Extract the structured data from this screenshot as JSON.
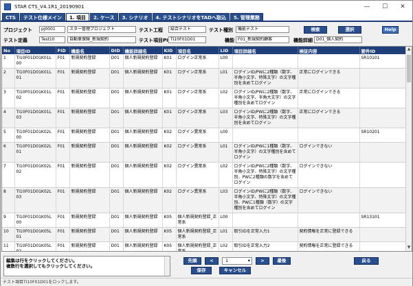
{
  "window": {
    "title": "STAR CTS_V4.1R1_20190901",
    "minimize": "—",
    "maximize": "☐",
    "close": "✕"
  },
  "tabs": [
    "CTS",
    "テスト仕様メイン",
    "1. 項目",
    "2. ケース",
    "3. シナリオ",
    "4. テストシナリオをTADへ取込",
    "5. 管理業務"
  ],
  "active_tab": 2,
  "fields": {
    "project_label": "プロジェクト",
    "project_id": "pj0001",
    "project_name": "スター管理プロジェクト",
    "test_process_label": "テスト工程",
    "test_process_value": "結合テスト",
    "test_type_label": "テスト種別",
    "test_type_value": "機能テスト",
    "test_def_label": "テスト定義",
    "test_def_id": "Test10",
    "test_def_name": "自動車保険_新規契約",
    "test_item_pid_label": "テスト項目PID",
    "test_item_pid_value": "TI10F01D01",
    "function_label": "機能",
    "function_value": "F01_新規契約顧客",
    "function_detail_label": "機能詳細",
    "function_detail_value": "D01_個人契約"
  },
  "buttons": {
    "search": "検索",
    "select": "選択",
    "help": "Help",
    "first": "先頭",
    "prev": "<",
    "next": ">",
    "last": "最後",
    "save": "保存",
    "cancel": "キャンセル",
    "back": "戻る"
  },
  "page_select": "1",
  "columns": [
    "No",
    "項目ID",
    "FID",
    "機能名",
    "DID",
    "機能詳細名",
    "KID",
    "項目名",
    "LID",
    "項目詳細名",
    "検証内容",
    "要件ID"
  ],
  "rows": [
    [
      "1",
      "TI10F01D01K01L00",
      "F01",
      "新規契約登録",
      "D01",
      "個人新規契約登録",
      "K01",
      "ログイン正常系",
      "L00",
      "",
      "",
      "SR10101"
    ],
    [
      "2",
      "TI10F01D01K01L01",
      "F01",
      "新規契約登録",
      "D01",
      "個人新規契約登録",
      "K01",
      "ログイン正常系",
      "L01",
      "ログインID/PWに2種類（数字、半角小文字、特殊文字）の文字種別を含めてログイン",
      "正常にログインできる",
      ""
    ],
    [
      "3",
      "TI10F01D01K01L02",
      "F01",
      "新規契約登録",
      "D01",
      "個人新規契約登録",
      "K01",
      "ログイン正常系",
      "L02",
      "ログインID/PWに2種類（数字、半角小文字、半角大文字）の文字種別を含めてログイン",
      "正常にログインできる",
      ""
    ],
    [
      "4",
      "TI10F01D01K01L03",
      "F01",
      "新規契約登録",
      "D01",
      "個人新規契約登録",
      "K01",
      "ログイン正常系",
      "L03",
      "ログインID/PWに2種類（数字、半角小文字、特殊文字）の文字種別を含めてログイン",
      "正常にログインできる",
      ""
    ],
    [
      "5",
      "TI10F01D01K02L00",
      "F01",
      "新規契約登録",
      "D01",
      "個人新規契約登録",
      "K02",
      "ログイン異常系",
      "L00",
      "",
      "",
      "SR10201"
    ],
    [
      "6",
      "TI10F01D01K02L01",
      "F01",
      "新規契約登録",
      "D01",
      "個人新規契約登録",
      "K02",
      "ログイン異常系",
      "L01",
      "ログインID/PWに1種類（数字、半角小文字）の文字種別を含めてログイン",
      "ログインできない",
      ""
    ],
    [
      "7",
      "TI10F01D01K02L02",
      "F01",
      "新規契約登録",
      "D01",
      "個人新規契約登録",
      "K02",
      "ログイン異常系",
      "L02",
      "ログインID/PWに2種類（数字、半角小文字、特殊文字）の文字種別、PWに2種類の数字を含めてログイン",
      "ログインできない",
      ""
    ],
    [
      "8",
      "TI10F01D01K02L03",
      "F01",
      "新規契約登録",
      "D01",
      "個人新規契約登録",
      "K02",
      "ログイン異常系",
      "L03",
      "ログインID/PWに2種類（数字、半角小文字、特殊文字）の文字種別、PWに1種類（数字）の文字種別を含めてログイン",
      "ログインできない",
      ""
    ],
    [
      "9",
      "TI10F01D01K05L00",
      "F01",
      "新規契約登録",
      "D01",
      "個人新規契約登録",
      "K05",
      "個人新規契約登録_正常系",
      "L00",
      "",
      "",
      "SR13101"
    ],
    [
      "10",
      "TI10F01D01K05L01",
      "F01",
      "新規契約登録",
      "D01",
      "個人新規契約登録",
      "K05",
      "個人新規契約登録_正常系",
      "L01",
      "取引IDを正常入力1",
      "契約情報を正常に登録できる",
      ""
    ],
    [
      "11",
      "TI10F01D01K05L02",
      "F01",
      "新規契約登録",
      "D01",
      "個人新規契約登録",
      "K05",
      "個人新規契約登録_正常系",
      "L02",
      "取引IDを正常入力2",
      "契約情報を正常に登録できる",
      ""
    ]
  ],
  "notes": {
    "line1": "編集は行をクリックしてください。",
    "line2": "複数行を選択してもクリックしてください。"
  },
  "status": "テスト項目TI10F01D01をロックします。"
}
